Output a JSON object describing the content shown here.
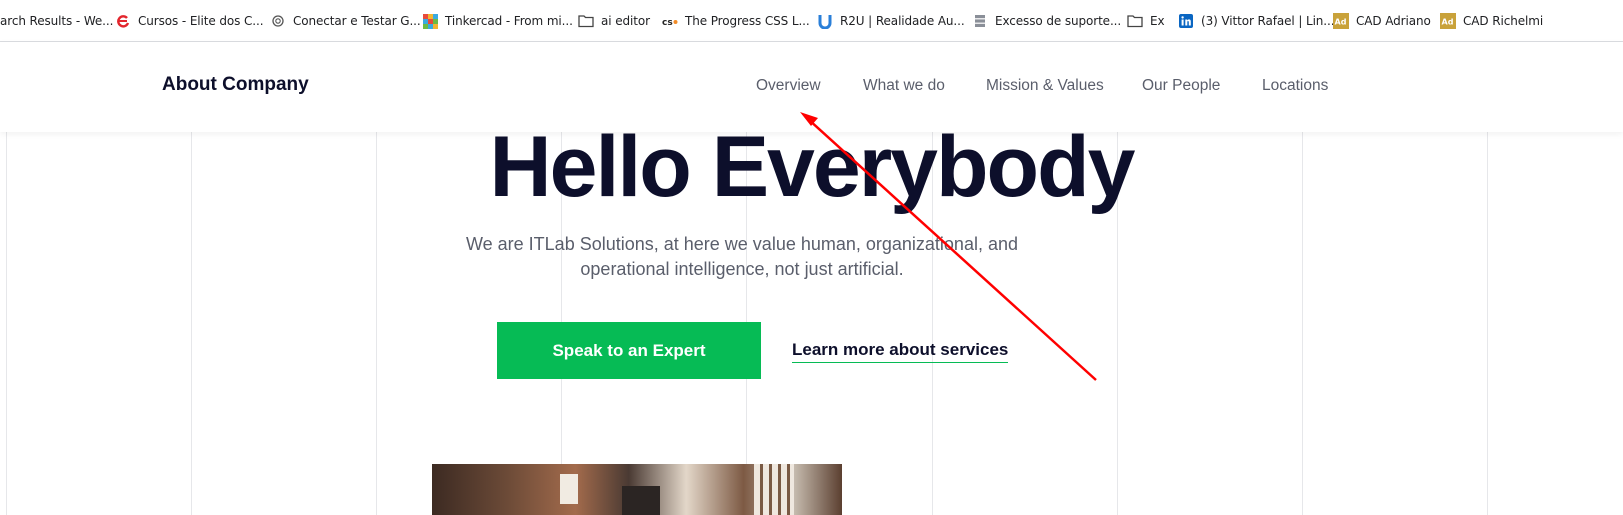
{
  "bookmarks": [
    {
      "label": "arch Results - We...",
      "icon": "search-results-icon"
    },
    {
      "label": "Cursos - Elite dos C...",
      "icon": "elite-logo-icon"
    },
    {
      "label": "Conectar e Testar G...",
      "icon": "openai-icon"
    },
    {
      "label": "Tinkercad - From mi...",
      "icon": "tinkercad-icon"
    },
    {
      "label": "ai editor",
      "icon": "folder-icon"
    },
    {
      "label": "The Progress CSS L...",
      "icon": "css-icon"
    },
    {
      "label": "R2U | Realidade Au...",
      "icon": "r2u-icon"
    },
    {
      "label": "Excesso de suporte...",
      "icon": "database-icon"
    },
    {
      "label": "Ex",
      "icon": "folder-icon"
    },
    {
      "label": "(3) Vittor Rafael | Lin...",
      "icon": "linkedin-icon"
    },
    {
      "label": "CAD Adriano",
      "icon": "ad-badge-icon"
    },
    {
      "label": "CAD Richelmi",
      "icon": "ad-badge-icon"
    }
  ],
  "header": {
    "brand": "About Company",
    "nav": [
      "Overview",
      "What we do",
      "Mission & Values",
      "Our People",
      "Locations"
    ]
  },
  "hero": {
    "title": "Hello Everybody",
    "subtitle": "We are ITLab Solutions, at here we value human, organizational, and operational intelligence, not just artificial.",
    "primary_cta": "Speak to an Expert",
    "secondary_cta": "Learn more about services"
  },
  "colors": {
    "accent_green": "#06bb55",
    "heading_navy": "#0d0f2b",
    "annotation_red": "#ff0000"
  }
}
